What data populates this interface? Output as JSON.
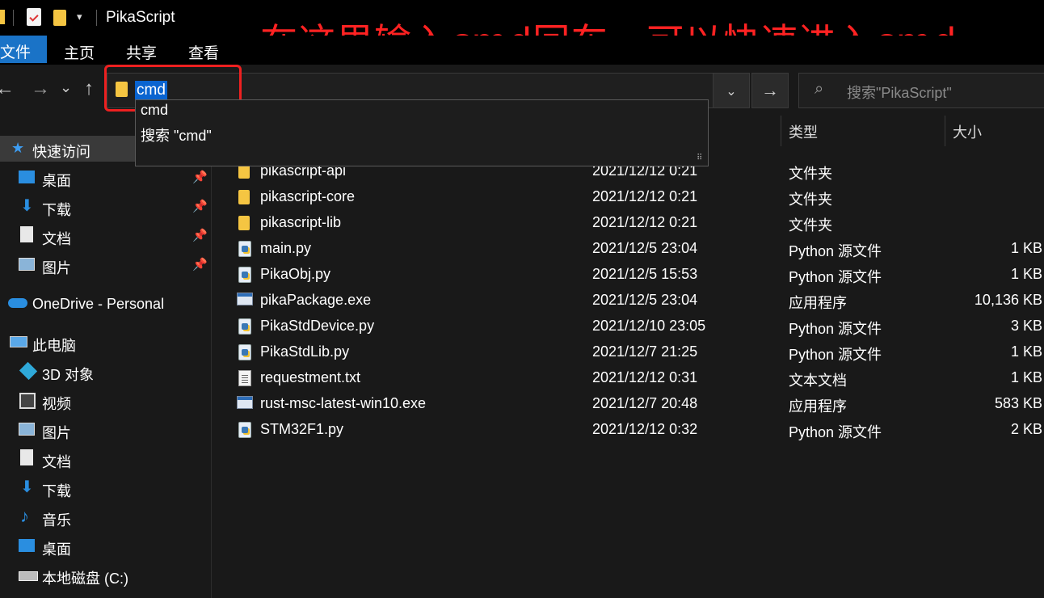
{
  "window": {
    "title": "PikaScript"
  },
  "annotation": "在这里输入cmd回车，可以快速进入cmd",
  "ribbon": {
    "tabs": [
      "文件",
      "主页",
      "共享",
      "查看"
    ]
  },
  "address_bar": {
    "value": "cmd"
  },
  "dropdown": {
    "items": [
      "cmd",
      "搜索 \"cmd\""
    ]
  },
  "search": {
    "placeholder": "搜索\"PikaScript\""
  },
  "sidebar": {
    "quick_access": "快速访问",
    "quick_items": [
      "桌面",
      "下载",
      "文档",
      "图片"
    ],
    "onedrive": "OneDrive - Personal",
    "this_pc": "此电脑",
    "pc_items": [
      "3D 对象",
      "视频",
      "图片",
      "文档",
      "下载",
      "音乐",
      "桌面",
      "本地磁盘 (C:)"
    ]
  },
  "columns": {
    "type": "类型",
    "size": "大小"
  },
  "files": [
    {
      "name": "pikascript-api",
      "date": "2021/12/12 0:21",
      "type": "文件夹",
      "size": "",
      "icon": "folder"
    },
    {
      "name": "pikascript-core",
      "date": "2021/12/12 0:21",
      "type": "文件夹",
      "size": "",
      "icon": "folder"
    },
    {
      "name": "pikascript-lib",
      "date": "2021/12/12 0:21",
      "type": "文件夹",
      "size": "",
      "icon": "folder"
    },
    {
      "name": "main.py",
      "date": "2021/12/5 23:04",
      "type": "Python 源文件",
      "size": "1 KB",
      "icon": "python"
    },
    {
      "name": "PikaObj.py",
      "date": "2021/12/5 15:53",
      "type": "Python 源文件",
      "size": "1 KB",
      "icon": "python"
    },
    {
      "name": "pikaPackage.exe",
      "date": "2021/12/5 23:04",
      "type": "应用程序",
      "size": "10,136 KB",
      "icon": "exe"
    },
    {
      "name": "PikaStdDevice.py",
      "date": "2021/12/10 23:05",
      "type": "Python 源文件",
      "size": "3 KB",
      "icon": "python"
    },
    {
      "name": "PikaStdLib.py",
      "date": "2021/12/7 21:25",
      "type": "Python 源文件",
      "size": "1 KB",
      "icon": "python"
    },
    {
      "name": "requestment.txt",
      "date": "2021/12/12 0:31",
      "type": "文本文档",
      "size": "1 KB",
      "icon": "text"
    },
    {
      "name": "rust-msc-latest-win10.exe",
      "date": "2021/12/7 20:48",
      "type": "应用程序",
      "size": "583 KB",
      "icon": "exe"
    },
    {
      "name": "STM32F1.py",
      "date": "2021/12/12 0:32",
      "type": "Python 源文件",
      "size": "2 KB",
      "icon": "python"
    }
  ],
  "colors": {
    "accent": "#1a73c7",
    "annotation": "#ff2222",
    "selection": "#0a64d0",
    "background": "#191919"
  }
}
